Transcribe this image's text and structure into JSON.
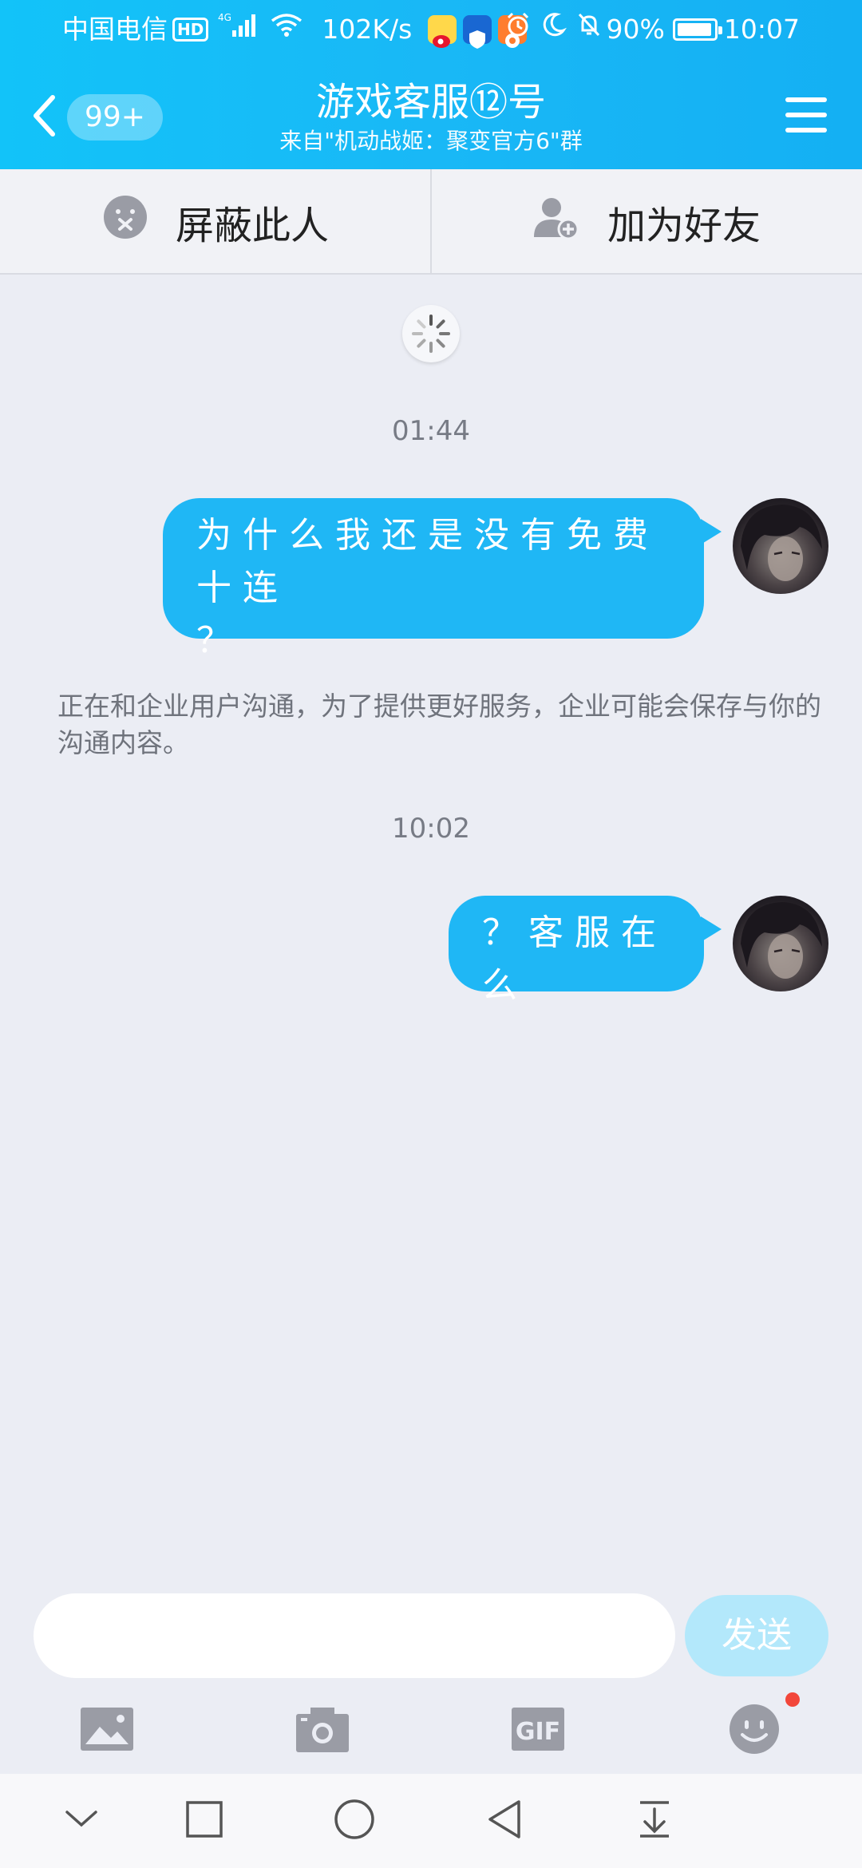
{
  "status_bar": {
    "carrier": "中国电信",
    "hd": "HD",
    "network": "4G",
    "speed": "102K/s",
    "battery": "90%",
    "time": "10:07"
  },
  "header": {
    "back_badge": "99+",
    "title": "游戏客服⑫号",
    "subtitle": "来自\"机动战姬：聚变官方6\"群",
    "background_color": "#19b8f6"
  },
  "action_bar": {
    "block_label": "屏蔽此人",
    "add_friend_label": "加为好友"
  },
  "chat": {
    "messages": [
      {
        "timestamp": "01:44",
        "text": "为什么我还是没有免费十连？",
        "line1": "为什么我还是没有免费十连",
        "line2": "？"
      },
      {
        "timestamp": "10:02",
        "text": "？客服在么"
      }
    ],
    "system_notice": "正在和企业用户沟通，为了提供更好服务，企业可能会保存与你的沟通内容。",
    "bubble_color": "#1fb7f5"
  },
  "input": {
    "placeholder": "",
    "send_label": "发送"
  },
  "toolbar": {
    "icons": [
      "image-icon",
      "camera-icon",
      "gif-icon",
      "emoji-icon"
    ],
    "gif_label": "GIF"
  },
  "nav_bar": {
    "icons": [
      "hide-keyboard-icon",
      "recent-apps-icon",
      "home-icon",
      "back-icon",
      "notification-pulldown-icon"
    ]
  }
}
